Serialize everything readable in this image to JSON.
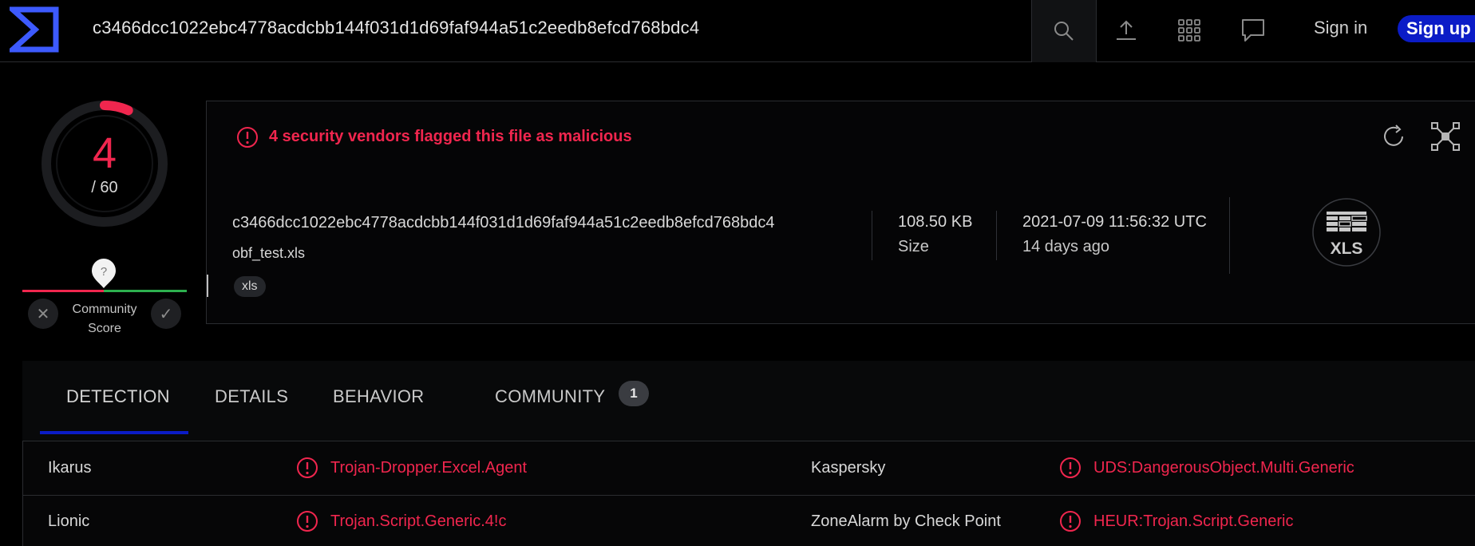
{
  "header": {
    "search_value": "c3466dcc1022ebc4778acdcbb144f031d1d69faf944a51c2eedb8efcd768bdc4",
    "icons": [
      "search-icon",
      "upload-icon",
      "apps-grid-icon",
      "chat-icon"
    ],
    "sign_in": "Sign in",
    "sign_up": "Sign up"
  },
  "score": {
    "detected": "4",
    "total": "/ 60",
    "detected_value": 4,
    "total_value": 60,
    "community_score_label_1": "Community",
    "community_score_label_2": "Score",
    "community_pin": "?"
  },
  "alert": {
    "text": "4 security vendors flagged this file as malicious"
  },
  "file": {
    "hash": "c3466dcc1022ebc4778acdcbb144f031d1d69faf944a51c2eedb8efcd768bdc4",
    "name": "obf_test.xls",
    "tag": "xls",
    "size_value": "108.50 KB",
    "size_label": "Size",
    "date": "2021-07-09 11:56:32 UTC",
    "date_ago": "14 days ago",
    "type_label": "XLS"
  },
  "tabs": [
    {
      "label": "DETECTION",
      "active": true
    },
    {
      "label": "DETAILS",
      "active": false
    },
    {
      "label": "BEHAVIOR",
      "active": false
    },
    {
      "label": "COMMUNITY",
      "active": false,
      "badge": "1"
    }
  ],
  "detections": [
    {
      "vendor": "Ikarus",
      "result": "Trojan-Dropper.Excel.Agent"
    },
    {
      "vendor": "Kaspersky",
      "result": "UDS:DangerousObject.Multi.Generic"
    },
    {
      "vendor": "Lionic",
      "result": "Trojan.Script.Generic.4!c"
    },
    {
      "vendor": "ZoneAlarm by Check Point",
      "result": "HEUR:Trojan.Script.Generic"
    }
  ],
  "colors": {
    "malicious": "#f0264e",
    "brand_blue": "#0b1cc7",
    "harmless": "#2db04f",
    "background": "#000000"
  }
}
